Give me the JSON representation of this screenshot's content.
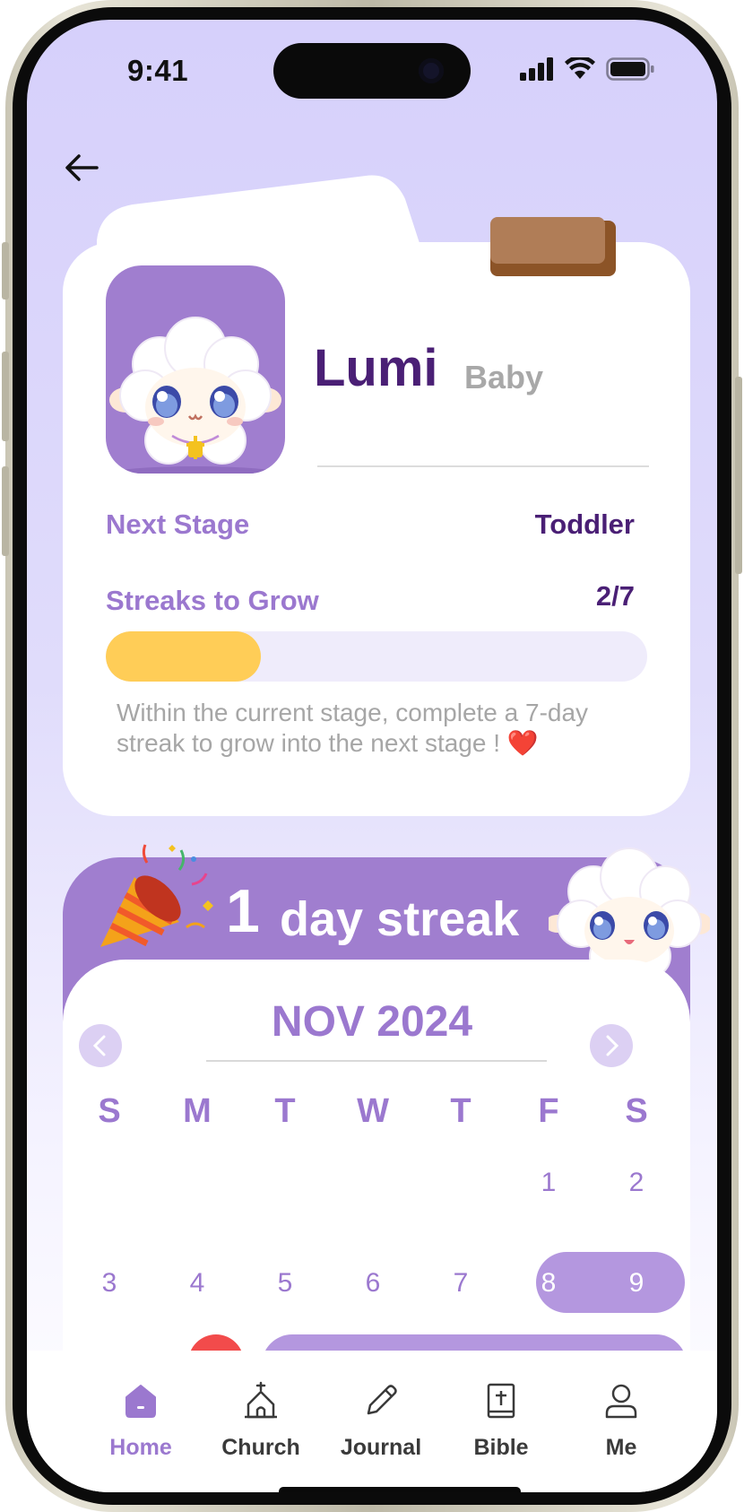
{
  "status_bar": {
    "time": "9:41"
  },
  "header": {
    "back_icon": "arrow-left-icon"
  },
  "pet": {
    "name": "Lumi",
    "stage": "Baby",
    "next_stage_label": "Next Stage",
    "next_stage_value": "Toddler",
    "streak_label": "Streaks to Grow",
    "streak_value": "2/7",
    "progress": 0.2857,
    "hint": "Within the current stage, complete a 7-day streak to grow into the next stage ! ❤️"
  },
  "streak": {
    "count": "1",
    "label": "day streak"
  },
  "calendar": {
    "month": "NOV 2024",
    "weekdays": [
      "S",
      "M",
      "T",
      "W",
      "T",
      "F",
      "S"
    ],
    "week1": [
      "1",
      "2"
    ],
    "week2": [
      "3",
      "4",
      "5",
      "6",
      "7",
      "8",
      "9"
    ],
    "highlighted_days": [
      "8",
      "9"
    ]
  },
  "tabs": [
    {
      "label": "Home",
      "icon": "home-icon",
      "active": true
    },
    {
      "label": "Church",
      "icon": "church-icon",
      "active": false
    },
    {
      "label": "Journal",
      "icon": "pencil-icon",
      "active": false
    },
    {
      "label": "Bible",
      "icon": "bible-icon",
      "active": false
    },
    {
      "label": "Me",
      "icon": "person-icon",
      "active": false
    }
  ],
  "colors": {
    "accent": "#9b78cf",
    "deep_purple": "#4a1f75",
    "banner": "#a07ecf",
    "progress": "#ffcd57",
    "background_top": "#d6d0fb"
  }
}
